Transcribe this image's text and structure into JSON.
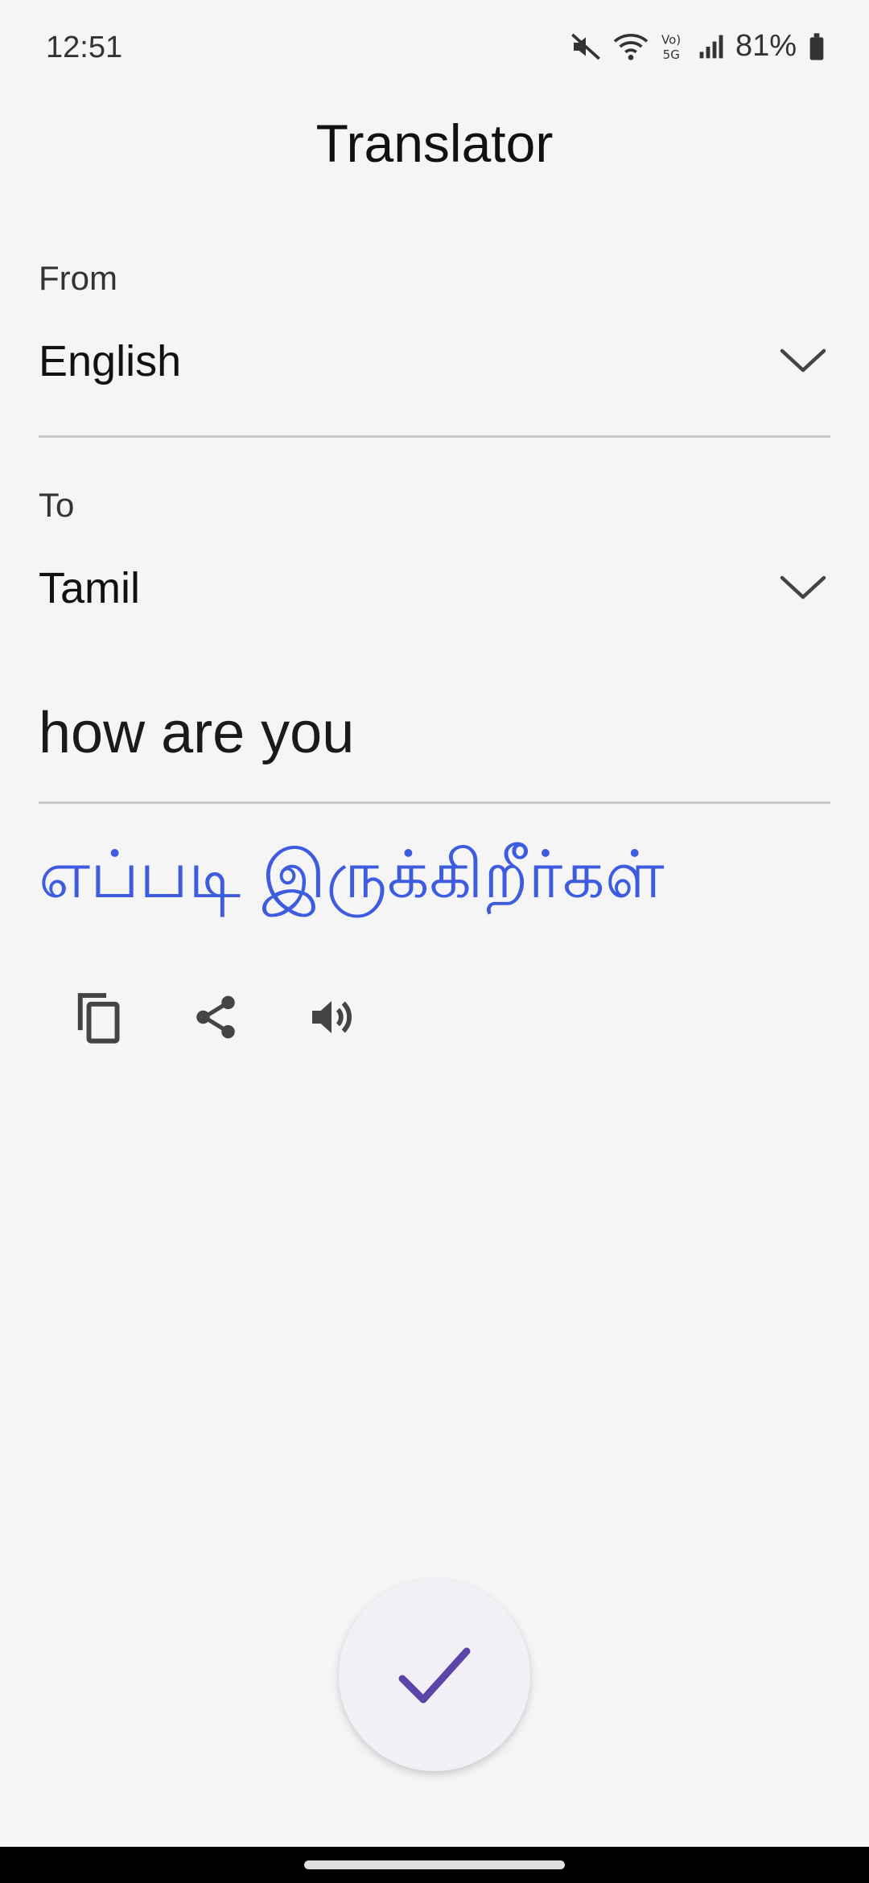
{
  "status_bar": {
    "time": "12:51",
    "battery": "81%",
    "icons": [
      "mute-icon",
      "wifi-icon",
      "volte-5g-icon",
      "signal-icon",
      "battery-icon"
    ]
  },
  "app": {
    "title": "Translator"
  },
  "from": {
    "label": "From",
    "value": "English"
  },
  "to": {
    "label": "To",
    "value": "Tamil"
  },
  "input": {
    "text": "how are you"
  },
  "output": {
    "text": "எப்படி இருக்கிறீர்கள்"
  },
  "actions": [
    "copy-icon",
    "share-icon",
    "volume-icon"
  ],
  "colors": {
    "accent": "#3d5ce0",
    "fab_check": "#5a45a8",
    "background": "#f5f5f5"
  }
}
